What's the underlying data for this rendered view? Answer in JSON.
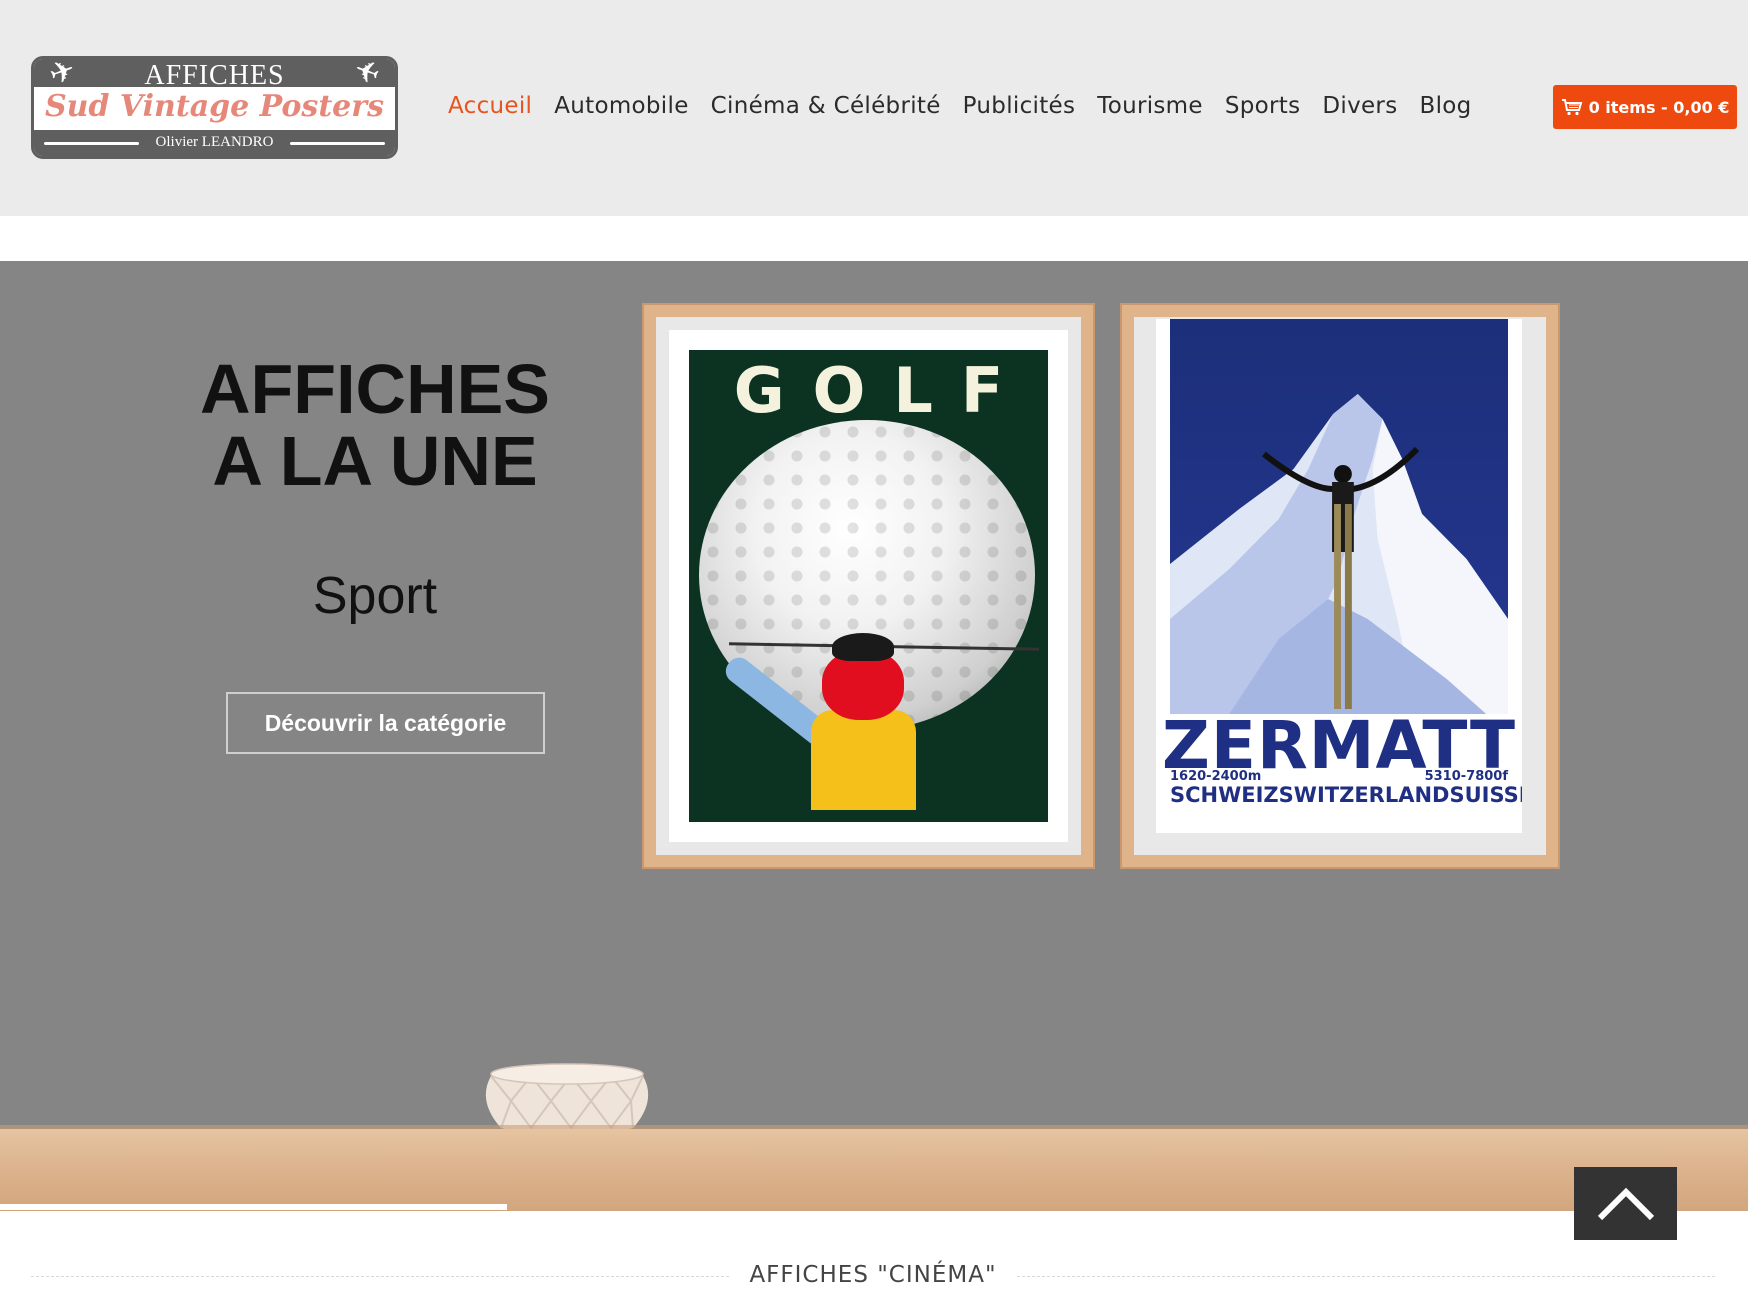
{
  "logo": {
    "top_text": "AFFICHES",
    "middle_text": "Sud Vintage Posters",
    "bottom_text": "Olivier LEANDRO",
    "icon": "airplane-icon"
  },
  "nav": {
    "items": [
      {
        "label": "Accueil",
        "active": true
      },
      {
        "label": "Automobile",
        "active": false
      },
      {
        "label": "Cinéma & Célébrité",
        "active": false
      },
      {
        "label": "Publicités",
        "active": false
      },
      {
        "label": "Tourisme",
        "active": false
      },
      {
        "label": "Sports",
        "active": false
      },
      {
        "label": "Divers",
        "active": false
      },
      {
        "label": "Blog",
        "active": false
      }
    ],
    "active_color": "#e6541f"
  },
  "cart": {
    "label": "0 items - 0,00 €",
    "icon": "cart-icon",
    "color": "#ee4a0f"
  },
  "hero": {
    "title_line1": "AFFICHES",
    "title_line2": "A LA UNE",
    "subtitle": "Sport",
    "button_label": "Découvrir la catégorie",
    "background": "#858585"
  },
  "posters": {
    "golf": {
      "word": "GOLF"
    },
    "zermatt": {
      "title": "ZERMATT",
      "alt_left": "1620-2400m",
      "alt_right": "5310-7800f",
      "sub_1": "SCHWEIZ",
      "sub_2": "SWITZERLAND",
      "sub_3": "SUISSE"
    }
  },
  "scroll_top": {
    "icon": "chevron-up-icon"
  },
  "section": {
    "title": "AFFICHES \"CINÉMA\""
  }
}
